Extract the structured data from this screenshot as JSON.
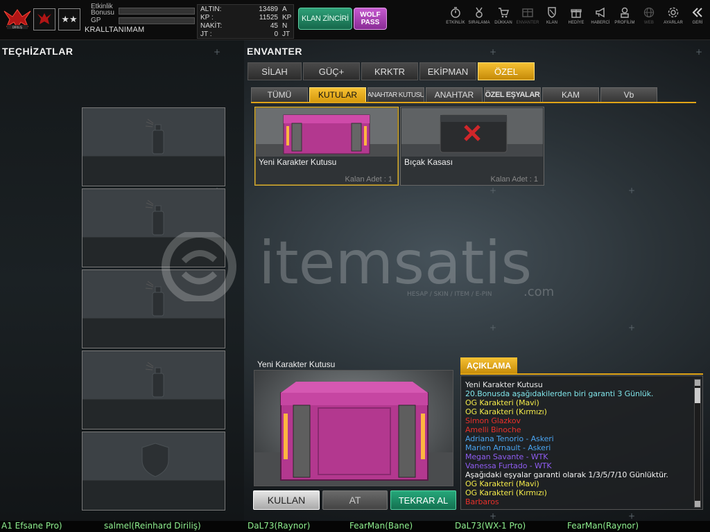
{
  "header": {
    "event_bonus_label_1": "Etkinlik",
    "event_bonus_label_2": "Bonusu",
    "gp_label": "GP",
    "username": "KRALLTANIMAM",
    "currency": [
      {
        "name": "ALTIN:",
        "value": "13489",
        "unit": "A"
      },
      {
        "name": "KP  :",
        "value": "11525",
        "unit": "KP"
      },
      {
        "name": "NAKİT:",
        "value": "45",
        "unit": "N"
      },
      {
        "name": "JT  :",
        "value": "0",
        "unit": "JT"
      }
    ],
    "klan_button": "KLAN ZİNCİRİ",
    "wolf_pass_line1": "WOLF",
    "wolf_pass_line2": "PASS",
    "nav": [
      {
        "label": "ETKİNLİK",
        "icon": "stopwatch-icon"
      },
      {
        "label": "SIRALAMA",
        "icon": "medal-icon"
      },
      {
        "label": "DÜKKAN",
        "icon": "cart-icon"
      },
      {
        "label": "ENVANTER",
        "icon": "inventory-icon"
      },
      {
        "label": "KLAN",
        "icon": "shield-icon"
      },
      {
        "label": "HEDİYE",
        "icon": "gift-icon"
      },
      {
        "label": "HABERCİ",
        "icon": "megaphone-icon"
      },
      {
        "label": "PROFİLİM",
        "icon": "profile-icon"
      },
      {
        "label": "WEB",
        "icon": "globe-icon"
      },
      {
        "label": "AYARLAR",
        "icon": "gear-icon"
      },
      {
        "label": "GERİ",
        "icon": "back-icon"
      }
    ]
  },
  "left_panel": {
    "title": "TEÇHİZATLAR"
  },
  "inventory": {
    "title": "ENVANTER",
    "main_tabs": [
      "SİLAH",
      "GÜÇ+",
      "KRKTR",
      "EKİPMAN",
      "ÖZEL"
    ],
    "sub_tabs": [
      "TÜMÜ",
      "KUTULAR",
      "ANAHTAR KUTUSU",
      "ANAHTAR",
      "ÖZEL EŞYALAR",
      "KAM",
      "Vb"
    ],
    "items": [
      {
        "name": "Yeni Karakter Kutusu",
        "qty": "Kalan Adet : 1"
      },
      {
        "name": "Bıçak Kasası",
        "qty": "Kalan Adet : 1"
      }
    ]
  },
  "watermark": {
    "brand": "itemsatis",
    "suffix": ".com",
    "tagline": "HESAP / SKIN / ITEM / E-PIN"
  },
  "preview": {
    "title": "Yeni Karakter Kutusu",
    "use_button": "KULLAN",
    "throw_button": "AT",
    "buy_again_button": "TEKRAR AL"
  },
  "description": {
    "tab": "AÇIKLAMA",
    "lines": [
      {
        "text": "Yeni Karakter Kutusu",
        "color": "#e6e6e6"
      },
      {
        "text": "20.Bonusda aşağıdakilerden biri garanti 3 Günlük.",
        "color": "#7fe3e8"
      },
      {
        "text": "OG Karakteri (Mavi)",
        "color": "#f2e94a"
      },
      {
        "text": "OG Karakteri (Kırmızı)",
        "color": "#f2e94a"
      },
      {
        "text": "Simon Glazkov",
        "color": "#e8302a"
      },
      {
        "text": "Amelli Binoche",
        "color": "#e8302a"
      },
      {
        "text": "Adriana Tenorio - Askeri",
        "color": "#49a3ef"
      },
      {
        "text": "Marien Arnault - Askeri",
        "color": "#49a3ef"
      },
      {
        "text": "Megan Savante - WTK",
        "color": "#8e5cf0"
      },
      {
        "text": "Vanessa Furtado - WTK",
        "color": "#8e5cf0"
      },
      {
        "text": "Aşağıdaki eşyalar garanti olarak 1/3/5/7/10 Günlüktür.",
        "color": "#f2f2f2"
      },
      {
        "text": "OG Karakteri (Mavi)",
        "color": "#f2e94a"
      },
      {
        "text": "OG Karakteri (Kırmızı)",
        "color": "#f2e94a"
      },
      {
        "text": "Barbaros",
        "color": "#e8302a"
      }
    ]
  },
  "ticker": [
    "A1 Efsane Pro)",
    "salmel(Reinhard Diriliş)",
    "DaL73(Raynor)",
    "FearMan(Bane)",
    "DaL73(WX-1 Pro)",
    "FearMan(Raynor)"
  ],
  "colors": {
    "accent": "#e2a517",
    "green_button": "#1a8a63",
    "purple_button": "#a23fae",
    "ticker_text": "#8ff08f"
  }
}
